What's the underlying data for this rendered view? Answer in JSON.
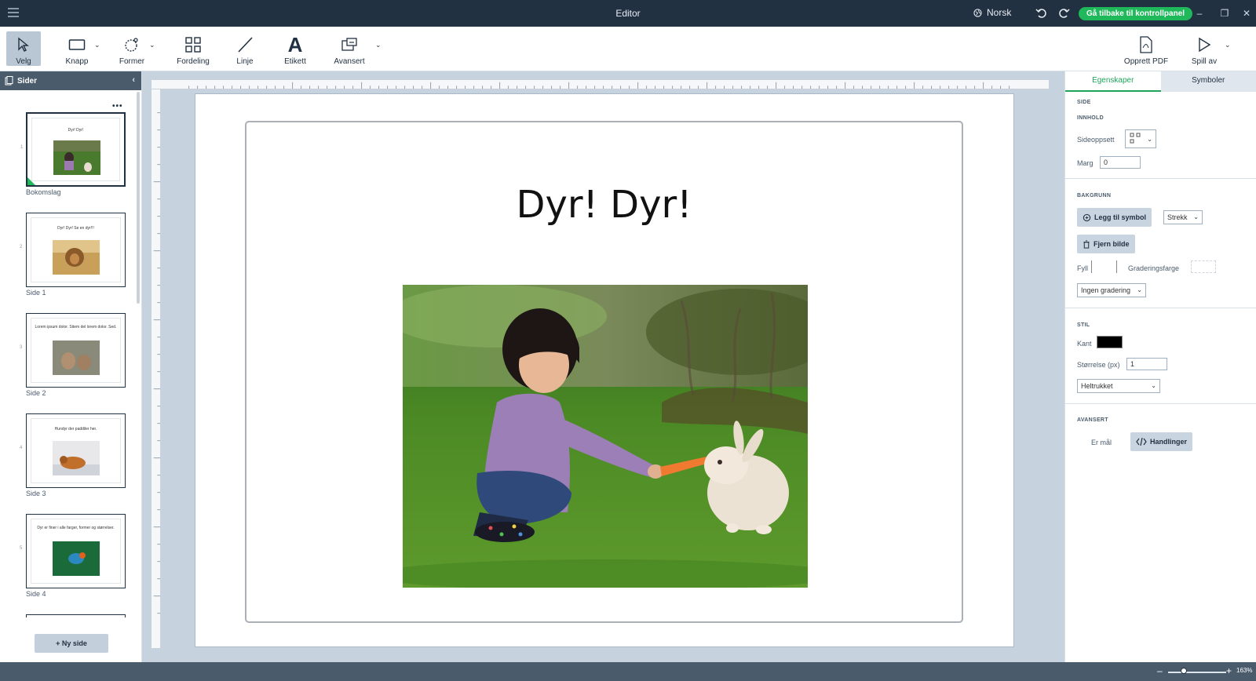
{
  "window": {
    "title": "Editor",
    "language": "Norsk",
    "back_label": "Gå tilbake til kontrollpanel",
    "minimize": "–",
    "maximize": "❐",
    "close": "✕"
  },
  "toolbar": {
    "velg": "Velg",
    "knapp": "Knapp",
    "former": "Former",
    "fordeling": "Fordeling",
    "linje": "Linje",
    "etikett": "Etikett",
    "avansert": "Avansert",
    "pdf": "Opprett PDF",
    "spill": "Spill av"
  },
  "pages_panel": {
    "title": "Sider",
    "more": "•••",
    "new_page": "+ Ny side",
    "items": [
      {
        "label": "Bokomslag",
        "text": "Dyr! Dyr!",
        "num": "1"
      },
      {
        "label": "Side 1",
        "text": "Dyr! Dyr! Se en dyr!!!",
        "num": "2"
      },
      {
        "label": "Side 2",
        "text": "Lorem ipsum dolor. Sitem del lorem dolor. Sed.",
        "num": "3"
      },
      {
        "label": "Side 3",
        "text": "Hundyr der paddiler her.",
        "num": "4"
      },
      {
        "label": "Side 4",
        "text": "Dyr er finer i alle farger, former og størrelser.",
        "num": "5"
      }
    ]
  },
  "canvas": {
    "title": "Dyr! Dyr!"
  },
  "props": {
    "tab_props": "Egenskaper",
    "tab_symbols": "Symboler",
    "side": "SIDE",
    "innhold": "INNHOLD",
    "sideoppsett": "Sideoppsett",
    "marg": "Marg",
    "marg_value": "0",
    "bakgrunn": "BAKGRUNN",
    "legg_til": "Legg til symbol",
    "strekk": "Strekk",
    "fjern": "Fjern bilde",
    "fyll": "Fyll",
    "gradering": "Graderingsfarge",
    "ingen": "Ingen gradering",
    "stil": "STIL",
    "kant": "Kant",
    "storrelse": "Størrelse (px)",
    "storrelse_value": "1",
    "heltrukket": "Heltrukket",
    "avansert": "AVANSERT",
    "er_mal": "Er mål",
    "handlinger": "Handlinger",
    "colors": {
      "kant": "#000000",
      "accent": "#1fa55a"
    }
  },
  "status": {
    "zoom_minus": "–",
    "zoom_plus": "+",
    "zoom": "163%"
  }
}
